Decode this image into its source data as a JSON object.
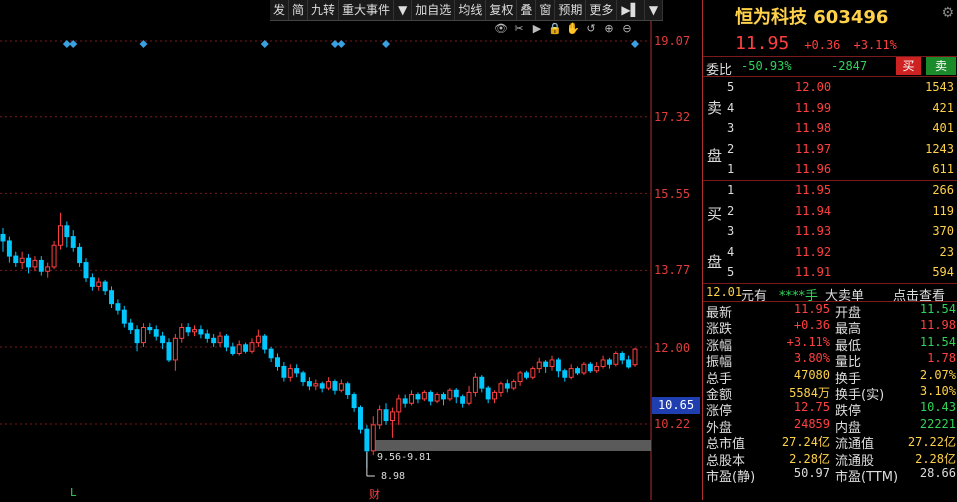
{
  "toolbar": {
    "items": [
      "发",
      "简",
      "九转",
      "重大事件",
      "▼",
      "加自选",
      "均线",
      "复权",
      "叠",
      "窗",
      "预期",
      "更多",
      "▶▌",
      "▼"
    ]
  },
  "chart_data": {
    "type": "candlestick",
    "y_tick_labels": [
      "19.07",
      "17.32",
      "15.55",
      "13.77",
      "12.00",
      "10.22"
    ],
    "y_ticks": [
      19.07,
      17.32,
      15.55,
      13.77,
      12.0,
      10.22
    ],
    "ylim": [
      8.6,
      19.4
    ],
    "current_price_label": "10.65",
    "current_price": 10.65,
    "annotations": [
      "9.56-9.81",
      "8.98"
    ],
    "range_band": [
      9.56,
      9.81
    ],
    "low_marker": 8.98,
    "bottom_labels": [
      "L",
      "财"
    ],
    "candles": [
      [
        14.6,
        14.45,
        14.75,
        14.2
      ],
      [
        14.45,
        14.1,
        14.55,
        13.95
      ],
      [
        14.1,
        13.95,
        14.2,
        13.85
      ],
      [
        13.95,
        14.05,
        14.2,
        13.8
      ],
      [
        14.05,
        13.85,
        14.15,
        13.7
      ],
      [
        13.85,
        14.0,
        14.1,
        13.75
      ],
      [
        14.0,
        13.75,
        14.1,
        13.65
      ],
      [
        13.75,
        13.85,
        13.95,
        13.6
      ],
      [
        13.85,
        14.35,
        14.45,
        13.8
      ],
      [
        14.35,
        14.8,
        15.1,
        14.25
      ],
      [
        14.8,
        14.55,
        14.9,
        14.3
      ],
      [
        14.55,
        14.3,
        14.7,
        14.2
      ],
      [
        14.3,
        13.95,
        14.4,
        13.85
      ],
      [
        13.95,
        13.6,
        14.05,
        13.5
      ],
      [
        13.6,
        13.4,
        13.7,
        13.3
      ],
      [
        13.4,
        13.5,
        13.6,
        13.3
      ],
      [
        13.5,
        13.3,
        13.55,
        13.2
      ],
      [
        13.3,
        13.0,
        13.4,
        12.9
      ],
      [
        13.0,
        12.85,
        13.1,
        12.75
      ],
      [
        12.85,
        12.55,
        12.95,
        12.45
      ],
      [
        12.55,
        12.4,
        12.65,
        12.3
      ],
      [
        12.4,
        12.1,
        12.5,
        11.9
      ],
      [
        12.1,
        12.45,
        12.55,
        12.0
      ],
      [
        12.45,
        12.4,
        12.55,
        12.3
      ],
      [
        12.4,
        12.25,
        12.5,
        12.15
      ],
      [
        12.25,
        12.1,
        12.35,
        11.95
      ],
      [
        12.1,
        11.7,
        12.2,
        11.65
      ],
      [
        11.7,
        12.2,
        12.3,
        11.45
      ],
      [
        12.2,
        12.45,
        12.55,
        12.1
      ],
      [
        12.45,
        12.35,
        12.55,
        12.25
      ],
      [
        12.35,
        12.4,
        12.5,
        12.25
      ],
      [
        12.4,
        12.3,
        12.5,
        12.2
      ],
      [
        12.3,
        12.2,
        12.4,
        12.1
      ],
      [
        12.2,
        12.1,
        12.3,
        12.0
      ],
      [
        12.1,
        12.25,
        12.35,
        12.0
      ],
      [
        12.25,
        12.0,
        12.3,
        11.9
      ],
      [
        12.0,
        11.85,
        12.1,
        11.8
      ],
      [
        11.85,
        12.05,
        12.15,
        11.8
      ],
      [
        12.05,
        11.9,
        12.1,
        11.85
      ],
      [
        11.9,
        12.1,
        12.2,
        11.85
      ],
      [
        12.1,
        12.25,
        12.4,
        12.0
      ],
      [
        12.25,
        11.95,
        12.3,
        11.85
      ],
      [
        11.95,
        11.75,
        12.0,
        11.65
      ],
      [
        11.75,
        11.55,
        11.85,
        11.45
      ],
      [
        11.55,
        11.3,
        11.65,
        11.2
      ],
      [
        11.3,
        11.5,
        11.6,
        11.2
      ],
      [
        11.5,
        11.4,
        11.6,
        11.3
      ],
      [
        11.4,
        11.2,
        11.45,
        11.1
      ],
      [
        11.2,
        11.1,
        11.3,
        11.0
      ],
      [
        11.1,
        11.15,
        11.25,
        11.0
      ],
      [
        11.15,
        11.05,
        11.2,
        10.95
      ],
      [
        11.05,
        11.2,
        11.3,
        11.0
      ],
      [
        11.2,
        11.0,
        11.25,
        10.9
      ],
      [
        11.0,
        11.15,
        11.25,
        10.95
      ],
      [
        11.15,
        10.9,
        11.2,
        10.8
      ],
      [
        10.9,
        10.6,
        10.95,
        10.5
      ],
      [
        10.6,
        10.1,
        10.65,
        10.0
      ],
      [
        10.1,
        9.6,
        10.2,
        9.2
      ],
      [
        9.6,
        10.2,
        10.4,
        9.5
      ],
      [
        10.2,
        10.55,
        10.65,
        10.1
      ],
      [
        10.55,
        10.3,
        10.7,
        10.2
      ],
      [
        10.3,
        10.5,
        10.6,
        9.9
      ],
      [
        10.5,
        10.8,
        10.9,
        10.2
      ],
      [
        10.8,
        10.7,
        10.9,
        10.6
      ],
      [
        10.7,
        10.9,
        11.0,
        10.65
      ],
      [
        10.9,
        10.8,
        10.95,
        10.7
      ],
      [
        10.8,
        10.95,
        11.0,
        10.75
      ],
      [
        10.95,
        10.75,
        11.0,
        10.65
      ],
      [
        10.75,
        10.9,
        10.95,
        10.7
      ],
      [
        10.9,
        10.8,
        10.95,
        10.65
      ],
      [
        10.8,
        11.0,
        11.05,
        10.75
      ],
      [
        11.0,
        10.85,
        11.05,
        10.7
      ],
      [
        10.85,
        10.7,
        10.9,
        10.6
      ],
      [
        10.7,
        10.95,
        11.1,
        10.65
      ],
      [
        10.95,
        11.3,
        11.4,
        10.85
      ],
      [
        11.3,
        11.05,
        11.35,
        10.95
      ],
      [
        11.05,
        10.8,
        11.1,
        10.7
      ],
      [
        10.8,
        10.95,
        11.0,
        10.7
      ],
      [
        10.95,
        11.15,
        11.2,
        10.85
      ],
      [
        11.15,
        11.05,
        11.25,
        10.95
      ],
      [
        11.05,
        11.2,
        11.25,
        11.0
      ],
      [
        11.2,
        11.4,
        11.45,
        11.1
      ],
      [
        11.4,
        11.3,
        11.45,
        11.25
      ],
      [
        11.3,
        11.5,
        11.55,
        11.25
      ],
      [
        11.5,
        11.65,
        11.75,
        11.4
      ],
      [
        11.65,
        11.55,
        11.7,
        11.4
      ],
      [
        11.55,
        11.7,
        11.8,
        11.45
      ],
      [
        11.7,
        11.45,
        11.75,
        11.3
      ],
      [
        11.45,
        11.3,
        11.5,
        11.2
      ],
      [
        11.3,
        11.5,
        11.6,
        11.25
      ],
      [
        11.5,
        11.4,
        11.55,
        11.35
      ],
      [
        11.4,
        11.6,
        11.65,
        11.35
      ],
      [
        11.6,
        11.45,
        11.65,
        11.4
      ],
      [
        11.45,
        11.55,
        11.65,
        11.4
      ],
      [
        11.55,
        11.7,
        11.8,
        11.5
      ],
      [
        11.7,
        11.6,
        11.75,
        11.5
      ],
      [
        11.6,
        11.85,
        11.9,
        11.55
      ],
      [
        11.85,
        11.7,
        11.9,
        11.6
      ],
      [
        11.7,
        11.54,
        11.8,
        11.5
      ],
      [
        11.59,
        11.95,
        11.98,
        11.54
      ]
    ],
    "event_markers_index": [
      10,
      11,
      22,
      41,
      52,
      53,
      60,
      99
    ]
  },
  "panel": {
    "title": "恒为科技 603496",
    "price": "11.95",
    "change": "+0.36",
    "change_pct": "+3.11%",
    "weibi_label": "委比",
    "weibi_pct": "-50.93%",
    "weibi_diff": "-2847",
    "sell_btn": "买",
    "buy_btn": "卖",
    "ask_label": "卖盘",
    "bid_label": "买盘",
    "asks": [
      {
        "level": "5",
        "price": "12.00",
        "vol": "1543"
      },
      {
        "level": "4",
        "price": "11.99",
        "vol": "421"
      },
      {
        "level": "3",
        "price": "11.98",
        "vol": "401"
      },
      {
        "level": "2",
        "price": "11.97",
        "vol": "1243"
      },
      {
        "level": "1",
        "price": "11.96",
        "vol": "611"
      }
    ],
    "bids": [
      {
        "level": "1",
        "price": "11.95",
        "vol": "266"
      },
      {
        "level": "2",
        "price": "11.94",
        "vol": "119"
      },
      {
        "level": "3",
        "price": "11.93",
        "vol": "370"
      },
      {
        "level": "4",
        "price": "11.92",
        "vol": "23"
      },
      {
        "level": "5",
        "price": "11.91",
        "vol": "594"
      }
    ],
    "big_order": {
      "price": "12.01",
      "unit": "元有",
      "hands": "****手",
      "label": "大卖单",
      "link": "点击查看"
    },
    "stats": [
      {
        "k1": "最新",
        "v1": "11.95",
        "c1": "#ff4040",
        "k2": "开盘",
        "v2": "11.54",
        "c2": "#2fd35a"
      },
      {
        "k1": "涨跌",
        "v1": "+0.36",
        "c1": "#ff4040",
        "k2": "最高",
        "v2": "11.98",
        "c2": "#ff4040"
      },
      {
        "k1": "涨幅",
        "v1": "+3.11%",
        "c1": "#ff4040",
        "k2": "最低",
        "v2": "11.54",
        "c2": "#2fd35a"
      },
      {
        "k1": "振幅",
        "v1": "3.80%",
        "c1": "#ff4040",
        "k2": "量比",
        "v2": "1.78",
        "c2": "#ff4040"
      },
      {
        "k1": "总手",
        "v1": "47080",
        "c1": "#ffd24a",
        "k2": "换手",
        "v2": "2.07%",
        "c2": "#ffd24a"
      },
      {
        "k1": "金额",
        "v1": "5584万",
        "c1": "#ffd24a",
        "k2": "换手(实)",
        "v2": "3.10%",
        "c2": "#ffd24a"
      },
      {
        "k1": "涨停",
        "v1": "12.75",
        "c1": "#ff4040",
        "k2": "跌停",
        "v2": "10.43",
        "c2": "#2fd35a"
      },
      {
        "k1": "外盘",
        "v1": "24859",
        "c1": "#ff4040",
        "k2": "内盘",
        "v2": "22221",
        "c2": "#2fd35a"
      },
      {
        "k1": "总市值",
        "v1": "27.24亿",
        "c1": "#ffd24a",
        "k2": "流通值",
        "v2": "27.22亿",
        "c2": "#ffd24a"
      },
      {
        "k1": "总股本",
        "v1": "2.28亿",
        "c1": "#ffd24a",
        "k2": "流通股",
        "v2": "2.28亿",
        "c2": "#ffd24a"
      },
      {
        "k1": "市盈(静)",
        "v1": "50.97",
        "c1": "#ddd",
        "k2": "市盈(TTM)",
        "v2": "28.66",
        "c2": "#ddd"
      }
    ]
  },
  "colors": {
    "up": "#ff4040",
    "down": "#00c8ff",
    "accent": "#ffd24a",
    "marker": "#3aa0e0"
  }
}
